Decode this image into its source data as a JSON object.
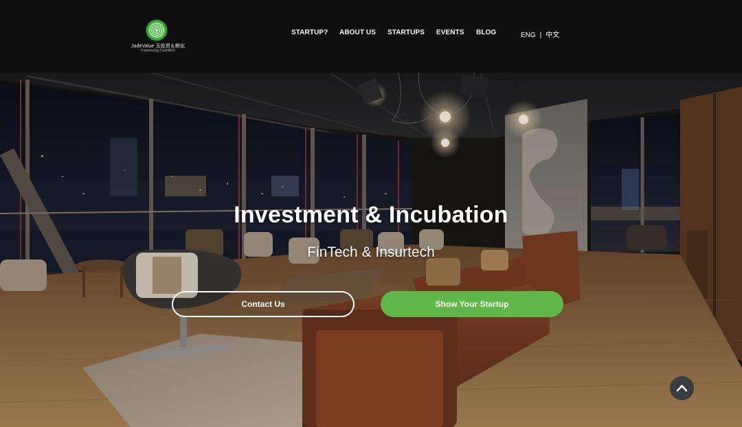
{
  "brand": {
    "name": "JadeValue 玉投资＆孵化",
    "tagline": "Powered by CashBUS",
    "logo_icon": "jade-ring-logo-icon",
    "accent_color": "#5fb848"
  },
  "nav": {
    "items": [
      {
        "label": "STARTUP?"
      },
      {
        "label": "ABOUT US"
      },
      {
        "label": "STARTUPS"
      },
      {
        "label": "EVENTS"
      },
      {
        "label": "BLOG"
      }
    ]
  },
  "language": {
    "english": "ENG",
    "separator": "|",
    "chinese": "中文"
  },
  "hero": {
    "title": "Investment & Incubation",
    "subtitle": "FinTech & Insurtech",
    "contact_button": "Contact Us",
    "startup_button": "Show Your Startup"
  },
  "scroll_top": {
    "icon": "chevron-up-icon"
  }
}
